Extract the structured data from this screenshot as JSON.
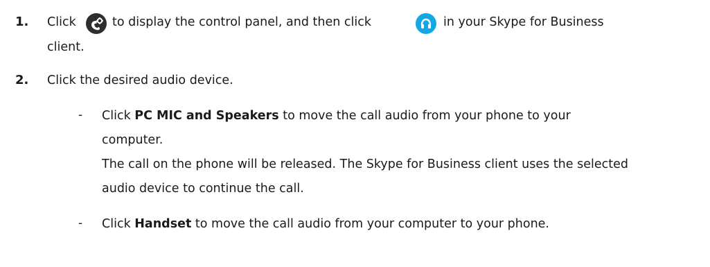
{
  "steps": [
    {
      "number": "1.",
      "line1": {
        "part1": "Click",
        "icon1": "phone-settings-icon",
        "part2": "to display the control panel, and then click",
        "icon2": "headset-icon",
        "part3": "in your Skype for Business"
      },
      "line2": "client."
    },
    {
      "number": "2.",
      "text": "Click the desired audio device.",
      "bullets": [
        {
          "dash": "-",
          "prefix": "Click ",
          "bold": "PC MIC and Speakers",
          "suffix": " to move the call audio from your phone to your",
          "line2": "computer.",
          "line3": "The call on the phone will be released. The Skype for Business client uses the selected",
          "line4": "audio device to continue the call."
        },
        {
          "dash": "-",
          "prefix": "Click ",
          "bold": "Handset",
          "suffix": " to move the call audio from your computer to your phone."
        }
      ]
    }
  ],
  "colors": {
    "dark_icon_bg": "#2e2e2e",
    "blue_icon_bg": "#14a7e6"
  }
}
